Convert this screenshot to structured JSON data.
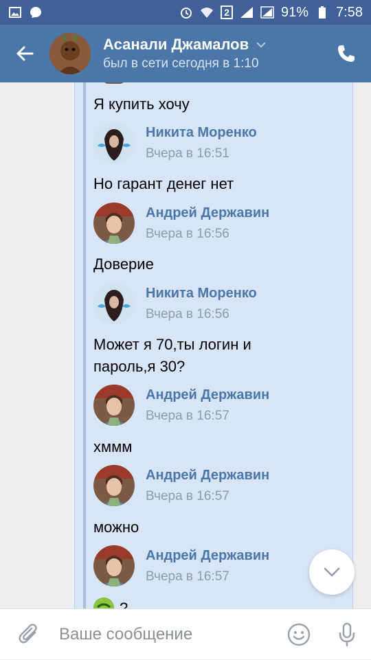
{
  "status_bar": {
    "battery": "91%",
    "time": "7:58",
    "sim_badge": "2"
  },
  "header": {
    "title": "Асанали Джамалов",
    "status": "был в сети сегодня в 1:10"
  },
  "messages": [
    {
      "type": "text",
      "text": "Я купить хочу"
    },
    {
      "type": "author",
      "name": "Никита Моренко",
      "time": "Вчера в 16:51"
    },
    {
      "type": "text",
      "text": "Но гарант денег нет"
    },
    {
      "type": "author",
      "name": "Андрей Державин",
      "time": "Вчера в 16:56"
    },
    {
      "type": "text",
      "text": "Доверие"
    },
    {
      "type": "author",
      "name": "Никита Моренко",
      "time": "Вчера в 16:56"
    },
    {
      "type": "text",
      "text": "Может я 70,ты логин и пароль,я 30?"
    },
    {
      "type": "author",
      "name": "Андрей Державин",
      "time": "Вчера в 16:57"
    },
    {
      "type": "text",
      "text": "хммм"
    },
    {
      "type": "author",
      "name": "Андрей Державин",
      "time": "Вчера в 16:57"
    },
    {
      "type": "text",
      "text": "можно"
    },
    {
      "type": "author",
      "name": "Андрей Державин",
      "time": "Вчера в 16:57"
    },
    {
      "type": "text",
      "text": "?"
    }
  ],
  "composer": {
    "placeholder": "Ваше сообщение"
  },
  "colors": {
    "header": "#4a76a8",
    "status_bar": "#40609a",
    "author_name": "#4a76a8",
    "forward_bg": "#d7e5f6"
  }
}
